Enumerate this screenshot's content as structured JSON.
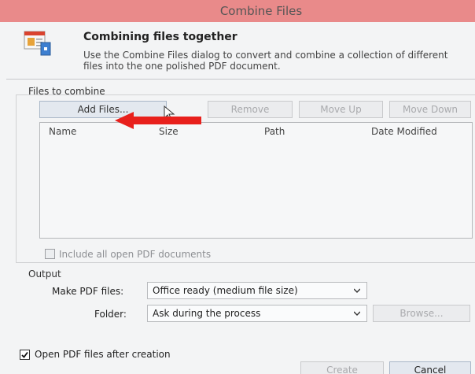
{
  "window": {
    "title": "Combine Files"
  },
  "header": {
    "title": "Combining files together",
    "description": "Use the Combine Files dialog to convert and combine a collection of different files into the one polished PDF document."
  },
  "files_section": {
    "label": "Files to combine",
    "buttons": {
      "add": "Add Files...",
      "remove": "Remove",
      "move_up": "Move Up",
      "move_down": "Move Down"
    },
    "columns": [
      "Name",
      "Size",
      "Path",
      "Date Modified"
    ],
    "include_open": {
      "label": "Include all open PDF documents",
      "checked": false,
      "enabled": false
    }
  },
  "output_section": {
    "label": "Output",
    "make_pdf": {
      "label": "Make PDF files:",
      "value": "Office ready (medium file size)"
    },
    "folder": {
      "label": "Folder:",
      "value": "Ask during the process"
    },
    "browse_label": "Browse..."
  },
  "open_after": {
    "label": "Open PDF files after creation",
    "checked": true
  },
  "footer": {
    "create_label": "Create",
    "cancel_label": "Cancel"
  },
  "colors": {
    "titlebar": "#e98a8a",
    "annotation_arrow": "#e8201c",
    "dialog_bg": "#f3f4f5"
  }
}
